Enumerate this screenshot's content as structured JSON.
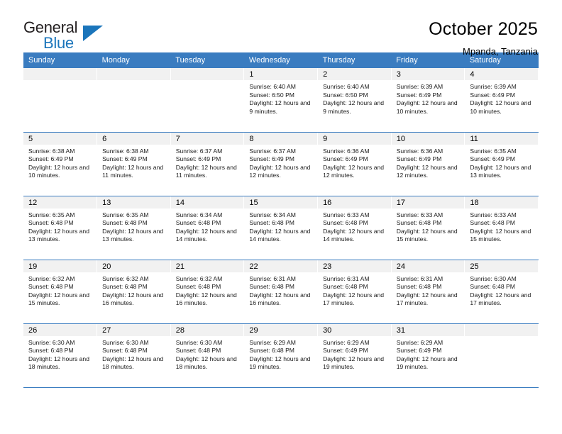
{
  "brand": {
    "word1": "General",
    "word2": "Blue",
    "triangle_color": "#1b75bb"
  },
  "header": {
    "title": "October 2025",
    "subtitle": "Mpanda, Tanzania"
  },
  "theme": {
    "header_blue": "#3a7cc0",
    "daynum_gray": "#f1f1f1",
    "text": "#000000"
  },
  "calendar": {
    "weekday_headers": [
      "Sunday",
      "Monday",
      "Tuesday",
      "Wednesday",
      "Thursday",
      "Friday",
      "Saturday"
    ],
    "weeks": [
      [
        {
          "day": "",
          "empty": true
        },
        {
          "day": "",
          "empty": true
        },
        {
          "day": "",
          "empty": true
        },
        {
          "day": "1",
          "sunrise": "Sunrise: 6:40 AM",
          "sunset": "Sunset: 6:50 PM",
          "daylight": "Daylight: 12 hours and 9 minutes."
        },
        {
          "day": "2",
          "sunrise": "Sunrise: 6:40 AM",
          "sunset": "Sunset: 6:50 PM",
          "daylight": "Daylight: 12 hours and 9 minutes."
        },
        {
          "day": "3",
          "sunrise": "Sunrise: 6:39 AM",
          "sunset": "Sunset: 6:49 PM",
          "daylight": "Daylight: 12 hours and 10 minutes."
        },
        {
          "day": "4",
          "sunrise": "Sunrise: 6:39 AM",
          "sunset": "Sunset: 6:49 PM",
          "daylight": "Daylight: 12 hours and 10 minutes."
        }
      ],
      [
        {
          "day": "5",
          "sunrise": "Sunrise: 6:38 AM",
          "sunset": "Sunset: 6:49 PM",
          "daylight": "Daylight: 12 hours and 10 minutes."
        },
        {
          "day": "6",
          "sunrise": "Sunrise: 6:38 AM",
          "sunset": "Sunset: 6:49 PM",
          "daylight": "Daylight: 12 hours and 11 minutes."
        },
        {
          "day": "7",
          "sunrise": "Sunrise: 6:37 AM",
          "sunset": "Sunset: 6:49 PM",
          "daylight": "Daylight: 12 hours and 11 minutes."
        },
        {
          "day": "8",
          "sunrise": "Sunrise: 6:37 AM",
          "sunset": "Sunset: 6:49 PM",
          "daylight": "Daylight: 12 hours and 12 minutes."
        },
        {
          "day": "9",
          "sunrise": "Sunrise: 6:36 AM",
          "sunset": "Sunset: 6:49 PM",
          "daylight": "Daylight: 12 hours and 12 minutes."
        },
        {
          "day": "10",
          "sunrise": "Sunrise: 6:36 AM",
          "sunset": "Sunset: 6:49 PM",
          "daylight": "Daylight: 12 hours and 12 minutes."
        },
        {
          "day": "11",
          "sunrise": "Sunrise: 6:35 AM",
          "sunset": "Sunset: 6:49 PM",
          "daylight": "Daylight: 12 hours and 13 minutes."
        }
      ],
      [
        {
          "day": "12",
          "sunrise": "Sunrise: 6:35 AM",
          "sunset": "Sunset: 6:48 PM",
          "daylight": "Daylight: 12 hours and 13 minutes."
        },
        {
          "day": "13",
          "sunrise": "Sunrise: 6:35 AM",
          "sunset": "Sunset: 6:48 PM",
          "daylight": "Daylight: 12 hours and 13 minutes."
        },
        {
          "day": "14",
          "sunrise": "Sunrise: 6:34 AM",
          "sunset": "Sunset: 6:48 PM",
          "daylight": "Daylight: 12 hours and 14 minutes."
        },
        {
          "day": "15",
          "sunrise": "Sunrise: 6:34 AM",
          "sunset": "Sunset: 6:48 PM",
          "daylight": "Daylight: 12 hours and 14 minutes."
        },
        {
          "day": "16",
          "sunrise": "Sunrise: 6:33 AM",
          "sunset": "Sunset: 6:48 PM",
          "daylight": "Daylight: 12 hours and 14 minutes."
        },
        {
          "day": "17",
          "sunrise": "Sunrise: 6:33 AM",
          "sunset": "Sunset: 6:48 PM",
          "daylight": "Daylight: 12 hours and 15 minutes."
        },
        {
          "day": "18",
          "sunrise": "Sunrise: 6:33 AM",
          "sunset": "Sunset: 6:48 PM",
          "daylight": "Daylight: 12 hours and 15 minutes."
        }
      ],
      [
        {
          "day": "19",
          "sunrise": "Sunrise: 6:32 AM",
          "sunset": "Sunset: 6:48 PM",
          "daylight": "Daylight: 12 hours and 15 minutes."
        },
        {
          "day": "20",
          "sunrise": "Sunrise: 6:32 AM",
          "sunset": "Sunset: 6:48 PM",
          "daylight": "Daylight: 12 hours and 16 minutes."
        },
        {
          "day": "21",
          "sunrise": "Sunrise: 6:32 AM",
          "sunset": "Sunset: 6:48 PM",
          "daylight": "Daylight: 12 hours and 16 minutes."
        },
        {
          "day": "22",
          "sunrise": "Sunrise: 6:31 AM",
          "sunset": "Sunset: 6:48 PM",
          "daylight": "Daylight: 12 hours and 16 minutes."
        },
        {
          "day": "23",
          "sunrise": "Sunrise: 6:31 AM",
          "sunset": "Sunset: 6:48 PM",
          "daylight": "Daylight: 12 hours and 17 minutes."
        },
        {
          "day": "24",
          "sunrise": "Sunrise: 6:31 AM",
          "sunset": "Sunset: 6:48 PM",
          "daylight": "Daylight: 12 hours and 17 minutes."
        },
        {
          "day": "25",
          "sunrise": "Sunrise: 6:30 AM",
          "sunset": "Sunset: 6:48 PM",
          "daylight": "Daylight: 12 hours and 17 minutes."
        }
      ],
      [
        {
          "day": "26",
          "sunrise": "Sunrise: 6:30 AM",
          "sunset": "Sunset: 6:48 PM",
          "daylight": "Daylight: 12 hours and 18 minutes."
        },
        {
          "day": "27",
          "sunrise": "Sunrise: 6:30 AM",
          "sunset": "Sunset: 6:48 PM",
          "daylight": "Daylight: 12 hours and 18 minutes."
        },
        {
          "day": "28",
          "sunrise": "Sunrise: 6:30 AM",
          "sunset": "Sunset: 6:48 PM",
          "daylight": "Daylight: 12 hours and 18 minutes."
        },
        {
          "day": "29",
          "sunrise": "Sunrise: 6:29 AM",
          "sunset": "Sunset: 6:48 PM",
          "daylight": "Daylight: 12 hours and 19 minutes."
        },
        {
          "day": "30",
          "sunrise": "Sunrise: 6:29 AM",
          "sunset": "Sunset: 6:49 PM",
          "daylight": "Daylight: 12 hours and 19 minutes."
        },
        {
          "day": "31",
          "sunrise": "Sunrise: 6:29 AM",
          "sunset": "Sunset: 6:49 PM",
          "daylight": "Daylight: 12 hours and 19 minutes."
        },
        {
          "day": "",
          "empty": true
        }
      ]
    ]
  }
}
